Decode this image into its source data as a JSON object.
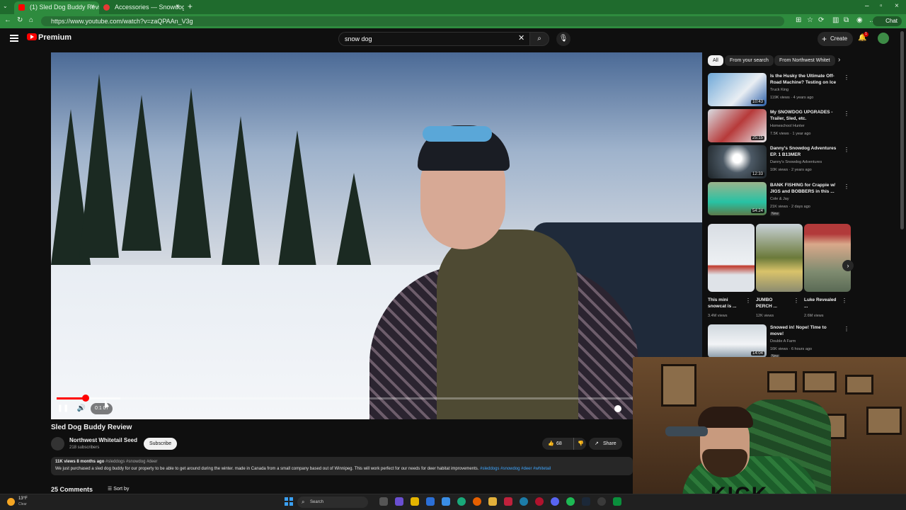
{
  "browser": {
    "tabs": [
      {
        "title": "(1) Sled Dog Buddy Review -",
        "active": true,
        "color": "#ff0000"
      },
      {
        "title": "Accessories — Snowdog",
        "active": false,
        "color": "#e53935"
      }
    ],
    "url": "https://www.youtube.com/watch?v=zaQPAAn_V3g",
    "chat_label": "Chat"
  },
  "header": {
    "brand": "Premium",
    "search_value": "snow dog"
  },
  "create_label": "Create",
  "notifications_count": "1",
  "player": {
    "time_display": "0:1 07",
    "progress_fraction": 0.05,
    "buffer_fraction": 0.11
  },
  "video": {
    "title": "Sled Dog Buddy Review",
    "channel": "Northwest Whitetail Seed",
    "subscribers": "218 subscribers",
    "subscribe_label": "Subscribe",
    "likes": "68",
    "share_label": "Share",
    "views_date": "11K views  8 months ago",
    "hashtags": "#sleddogs #snowdog #deer",
    "description": "We just purchased a sled dog buddy for our property to be able to get around during the winter. made in Canada from a small company based out of Winnipeg. This will work perfect for our needs for deer habitat improvements.",
    "desc_tags": "#sleddogs #snowdog #deer #whitetail",
    "comments_label": "25 Comments",
    "sort_label": "Sort by"
  },
  "sidebar": {
    "chips": [
      "All",
      "From your search",
      "From Northwest Whitet"
    ],
    "recs": [
      {
        "title": "Is the Husky the Ultimate Off-Road Machine? Testing on Ice ...",
        "channel": "Truck King",
        "meta": "119K views · 4 years ago",
        "duration": "10:43",
        "new": ""
      },
      {
        "title": "My SNOWDOG UPGRADES - Trailer, Sled, etc.",
        "channel": "Homeschool Hunter",
        "meta": "7.5K views · 1 year ago",
        "duration": "25:15",
        "new": ""
      },
      {
        "title": "Danny's Snowdog Adventures EP. 1   B13MER",
        "channel": "Danny's Snowdog Adventures",
        "meta": "10K views · 2 years ago",
        "duration": "12:33",
        "new": ""
      },
      {
        "title": "BANK FISHING for Crappie w/ JIGS and BOBBERS in this ...",
        "channel": "Cole & Jay",
        "meta": "21K views · 2 days ago",
        "duration": "54:24",
        "new": "New"
      }
    ],
    "shorts": [
      {
        "title": "This mini snowcat is ...",
        "views": "3.4M views"
      },
      {
        "title": "JUMBO PERCH ...",
        "views": "12K views"
      },
      {
        "title": "Luke Revealed ...",
        "views": "2.6M views"
      }
    ],
    "last_rec": {
      "title": "Snowed in! Nope! Time to move!",
      "channel": "Double A Farm",
      "meta": "16K views · 6 hours ago",
      "duration": "14:04",
      "new": "New"
    }
  },
  "webcam": {
    "shirt_text": "KICK"
  },
  "taskbar": {
    "weather_temp": "13°F",
    "weather_desc": "Clear",
    "search_placeholder": "Search"
  }
}
